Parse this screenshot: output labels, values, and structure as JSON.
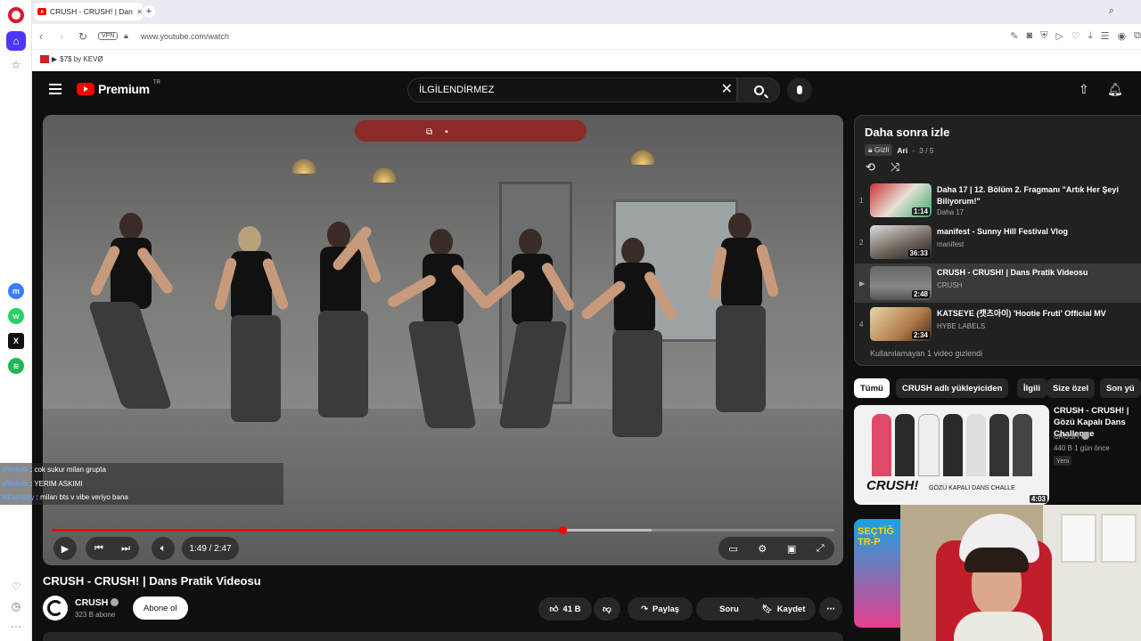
{
  "browser": {
    "tab_title": "CRUSH - CRUSH! | Dans Pratik Videosu",
    "url": "www.youtube.com/watch",
    "vpn_label": "VPN",
    "bookmark_label": "$7$ by KEVØ"
  },
  "header": {
    "logo_text": "Premium",
    "logo_country": "TR",
    "search_value": "İLGİLENDİRMEZ"
  },
  "player": {
    "time": "1:49 / 2:47",
    "progress_fraction": 0.653,
    "buffer_fraction": 0.766
  },
  "chat": [
    {
      "user": "ofifeltetk",
      "text": " : cok sukur milan grupta"
    },
    {
      "user": "ofifeltetk",
      "text": " : YERIM ASKIMI"
    },
    {
      "user": "kdramlasy",
      "text": " : milan bts v vibe veriyo bana"
    }
  ],
  "video": {
    "title": "CRUSH - CRUSH! | Dans Pratik Videosu",
    "channel": "CRUSH",
    "subscribers": "323 B abone",
    "subscribe_label": "Abone ol",
    "likes": "41 B",
    "share_label": "Paylaş",
    "ask_label": "Soru",
    "save_label": "Kaydet"
  },
  "playlist": {
    "title": "Daha sonra izle",
    "privacy": "Gizli",
    "owner": "Ari",
    "position": "3 / 5",
    "items": [
      {
        "index": "1",
        "title": "Daha 17 | 12. Bölüm 2. Fragmanı \"Artık Her Şeyi Biliyorum!\"",
        "channel": "Daha 17",
        "duration": "1:14"
      },
      {
        "index": "2",
        "title": "manifest - Sunny Hill Festival Vlog",
        "channel": "manifest",
        "duration": "36:33"
      },
      {
        "index": "▶",
        "title": "CRUSH - CRUSH! | Dans Pratik Videosu",
        "channel": "CRUSH",
        "duration": "2:48"
      },
      {
        "index": "4",
        "title": "KATSEYE (캣츠아이) 'Hootie Fruti' Official MV",
        "channel": "HYBE LABELS",
        "duration": "2:34"
      }
    ],
    "hidden_note": "Kullanılamayan 1 video gizlendi"
  },
  "chips": [
    "Tümü",
    "CRUSH adlı yükleyiciden",
    "İlgili",
    "Size özel",
    "Son yü"
  ],
  "recommendation": {
    "title": "CRUSH - CRUSH! | Gözü Kapalı Dans Challenge",
    "channel": "CRUSH",
    "stats": "440 B  1 gün önce",
    "badge": "Yeni",
    "thumb_text": "CRUSH!",
    "thumb_sub": "GÖZÜ KAPALI DANS CHALLE",
    "duration": "4:03"
  },
  "recommendation2": {
    "thumb_text": "SEÇTİĞ TR-P"
  }
}
